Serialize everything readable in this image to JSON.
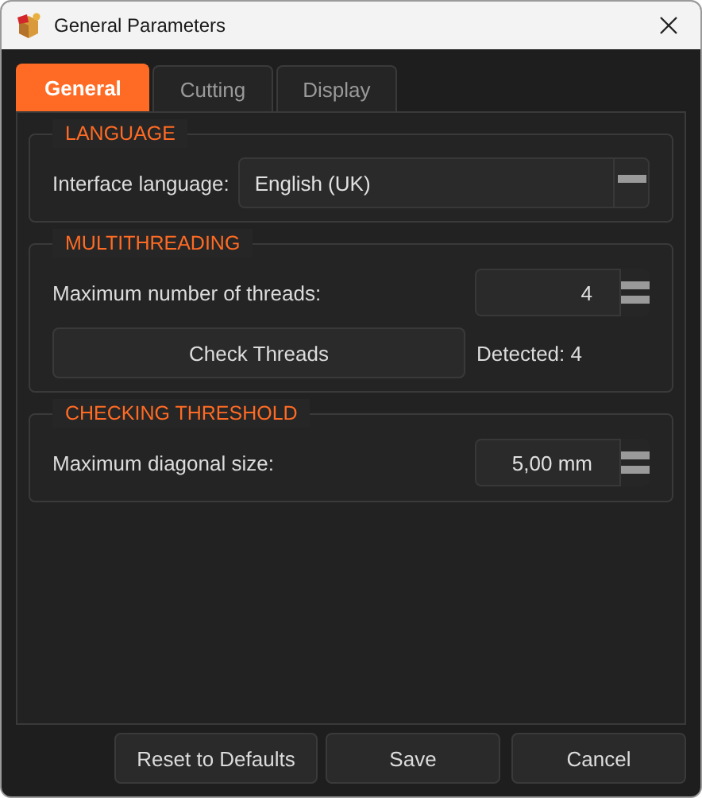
{
  "window": {
    "title": "General Parameters"
  },
  "tabs": [
    {
      "label": "General",
      "selected": true
    },
    {
      "label": "Cutting",
      "selected": false
    },
    {
      "label": "Display",
      "selected": false
    }
  ],
  "groups": [
    {
      "title": "LANGUAGE",
      "rows": [
        {
          "kind": "combo",
          "label": "Interface language:",
          "value": "English (UK)"
        }
      ]
    },
    {
      "title": "MULTITHREADING",
      "rows": [
        {
          "kind": "spin",
          "label": "Maximum number of threads:",
          "value": "4"
        },
        {
          "kind": "action",
          "button": "Check Threads",
          "note": "Detected: 4"
        }
      ]
    },
    {
      "title": "CHECKING THRESHOLD",
      "rows": [
        {
          "kind": "spin",
          "label": "Maximum diagonal size:",
          "value": "5,00 mm"
        }
      ]
    }
  ],
  "buttons": [
    "Reset to Defaults",
    "Save",
    "Cancel"
  ]
}
